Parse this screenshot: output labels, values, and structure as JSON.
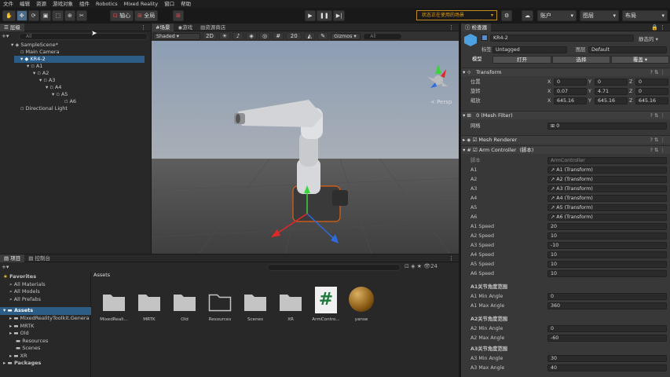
{
  "menu": [
    "文件",
    "编辑",
    "资源",
    "游戏对象",
    "组件",
    "Robotics",
    "Mixed Reality",
    "窗口",
    "帮助"
  ],
  "toolbar": {
    "tools": [
      "hand",
      "move",
      "rotate",
      "scale",
      "rect",
      "transform",
      "custom"
    ],
    "pivot_label": "轴心",
    "global_label": "全局",
    "status_text": "状态正在使用的场景",
    "account_label": "账户",
    "layers_label": "图层",
    "layout_label": "布局"
  },
  "hierarchy": {
    "tab": "层级",
    "search_placeholder": "All",
    "items": [
      "SampleScene*",
      "Main Camera",
      "KR4-2",
      "A1",
      "A2",
      "A3",
      "A4",
      "A5",
      "A6",
      "Directional Light"
    ]
  },
  "scene": {
    "tabs": [
      "场景",
      "游戏",
      "资源商店"
    ],
    "shading": "Shaded",
    "scale": "20",
    "gizmos": "Gizmos",
    "search_placeholder": "All",
    "persp_label": "< Persp"
  },
  "project": {
    "tabs": [
      "项目",
      "控制台"
    ],
    "favorites_title": "Favorites",
    "favorites": [
      "All Materials",
      "All Models",
      "All Prefabs"
    ],
    "assets_title": "Assets",
    "asset_tree": [
      "MixedRealityToolkit.Genera",
      "MRTK",
      "Old",
      "Resources",
      "Scenes",
      "XR"
    ],
    "packages_title": "Packages",
    "breadcrumb": "Assets",
    "count": "24",
    "assets": [
      "MixedReali...",
      "MRTK",
      "Old",
      "Resources",
      "Scenes",
      "XR",
      "ArmContro...",
      "yanse"
    ]
  },
  "inspector": {
    "tab": "检查器",
    "object_name": "KR4-2",
    "static_label": "静态的",
    "tag_label": "标签",
    "tag_value": "Untagged",
    "layer_label": "图层",
    "layer_value": "Default",
    "model_label": "模型",
    "open_button": "打开",
    "select_button": "选择",
    "overrides_button": "覆盖",
    "transform": {
      "title": "Transform",
      "position_label": "位置",
      "rotation_label": "旋转",
      "scale_label": "缩放",
      "position": {
        "x": "0",
        "y": "0",
        "z": "0"
      },
      "rotation": {
        "x": "0.07",
        "y": "4.71",
        "z": "0"
      },
      "scale": {
        "x": "645.16",
        "y": "645.16",
        "z": "645.16"
      }
    },
    "mesh_filter": {
      "title": "0 (Mesh Filter)",
      "mesh_label": "网格",
      "mesh_value": "0"
    },
    "mesh_renderer": {
      "title": "Mesh Renderer"
    },
    "arm_controller": {
      "title": "Arm Controller",
      "script_tag": "(脚本)",
      "script_label": "脚本",
      "script_value": "ArmController",
      "joints": [
        {
          "label": "A1",
          "value": "A1 (Transform)"
        },
        {
          "label": "A2",
          "value": "A2 (Transform)"
        },
        {
          "label": "A3",
          "value": "A3 (Transform)"
        },
        {
          "label": "A4",
          "value": "A4 (Transform)"
        },
        {
          "label": "A5",
          "value": "A5 (Transform)"
        },
        {
          "label": "A6",
          "value": "A6 (Transform)"
        }
      ],
      "speeds": [
        {
          "label": "A1 Speed",
          "value": "20"
        },
        {
          "label": "A2 Speed",
          "value": "10"
        },
        {
          "label": "A3 Speed",
          "value": "-10"
        },
        {
          "label": "A4 Speed",
          "value": "10"
        },
        {
          "label": "A5 Speed",
          "value": "10"
        },
        {
          "label": "A6 Speed",
          "value": "10"
        }
      ],
      "ranges": [
        {
          "header": "A1关节角度范围",
          "min_label": "A1 Min Angle",
          "min": "0",
          "max_label": "A1 Max Angle",
          "max": "360"
        },
        {
          "header": "A2关节角度范围",
          "min_label": "A2 Min Angle",
          "min": "0",
          "max_label": "A2 Max Angle",
          "max": "-60"
        },
        {
          "header": "A3关节角度范围",
          "min_label": "A3 Min Angle",
          "min": "30",
          "max_label": "A3 Max Angle",
          "max": "40"
        }
      ]
    }
  }
}
